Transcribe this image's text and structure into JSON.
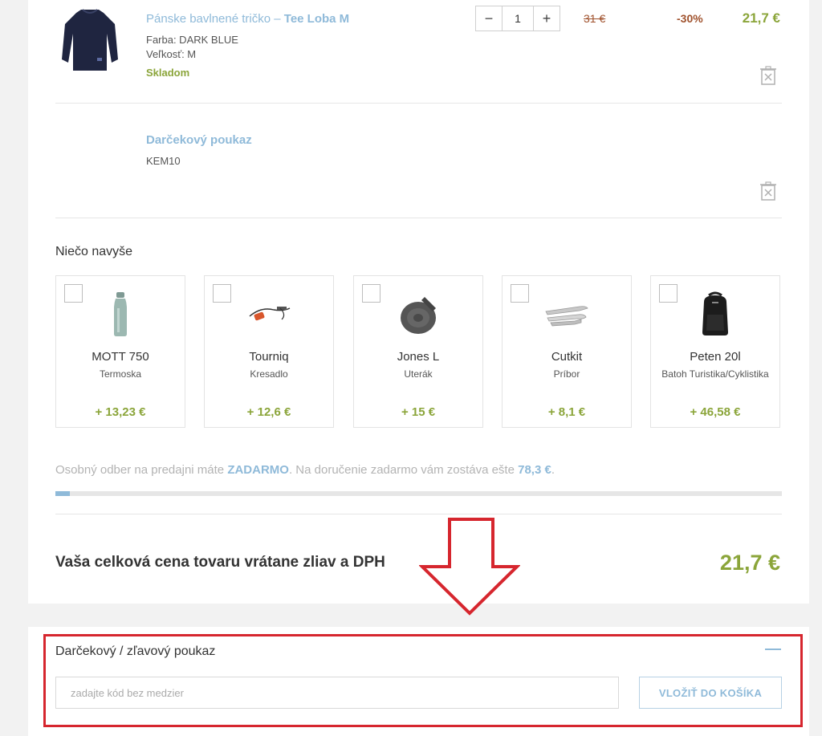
{
  "cart_items": [
    {
      "title_prefix": "Pánske bavlnené tričko – ",
      "title_bold": "Tee Loba M",
      "color_attr": "Farba: DARK BLUE",
      "size_attr": "Veľkosť: M",
      "stock": "Skladom",
      "qty_minus": "−",
      "qty_value": "1",
      "qty_plus": "+",
      "old_price": "31 €",
      "discount": "-30%",
      "price": "21,7 €",
      "icon": "trash-icon"
    },
    {
      "title": "Darčekový poukaz",
      "code": "KEM10",
      "icon": "trash-icon"
    }
  ],
  "upsell": {
    "heading": "Niečo navyše",
    "items": [
      {
        "name": "MOTT 750",
        "type": "Termoska",
        "price": "+ 13,23 €",
        "icon": "bottle-image"
      },
      {
        "name": "Tourniq",
        "type": "Kresadlo",
        "price": "+ 12,6 €",
        "icon": "firestarter-image"
      },
      {
        "name": "Jones L",
        "type": "Uterák",
        "price": "+ 15 €",
        "icon": "towel-image"
      },
      {
        "name": "Cutkit",
        "type": "Príbor",
        "price": "+ 8,1 €",
        "icon": "cutlery-image"
      },
      {
        "name": "Peten 20l",
        "type": "Batoh Turistika/Cyklistika",
        "price": "+ 46,58 €",
        "icon": "backpack-image"
      }
    ]
  },
  "delivery": {
    "text1": "Osobný odber na predajni máte ",
    "free": "ZADARMO",
    "text2": ". Na doručenie zadarmo vám zostáva ešte ",
    "remaining": "78,3 €",
    "text3": ".",
    "progress_fraction": 0.02
  },
  "total": {
    "label": "Vaša celková cena tovaru vrátane zliav a DPH",
    "price": "21,7 €"
  },
  "voucher": {
    "title": "Darčekový / zľavový poukaz",
    "placeholder": "zadajte kód bez medzier",
    "button": "VLOŽIŤ DO KOŠÍKA",
    "collapse_icon": "minus-icon"
  },
  "colors": {
    "accent_blue": "#8fbad9",
    "price_green": "#8ba53a",
    "discount_brown": "#a0522d",
    "highlight_red": "#d6262e"
  }
}
